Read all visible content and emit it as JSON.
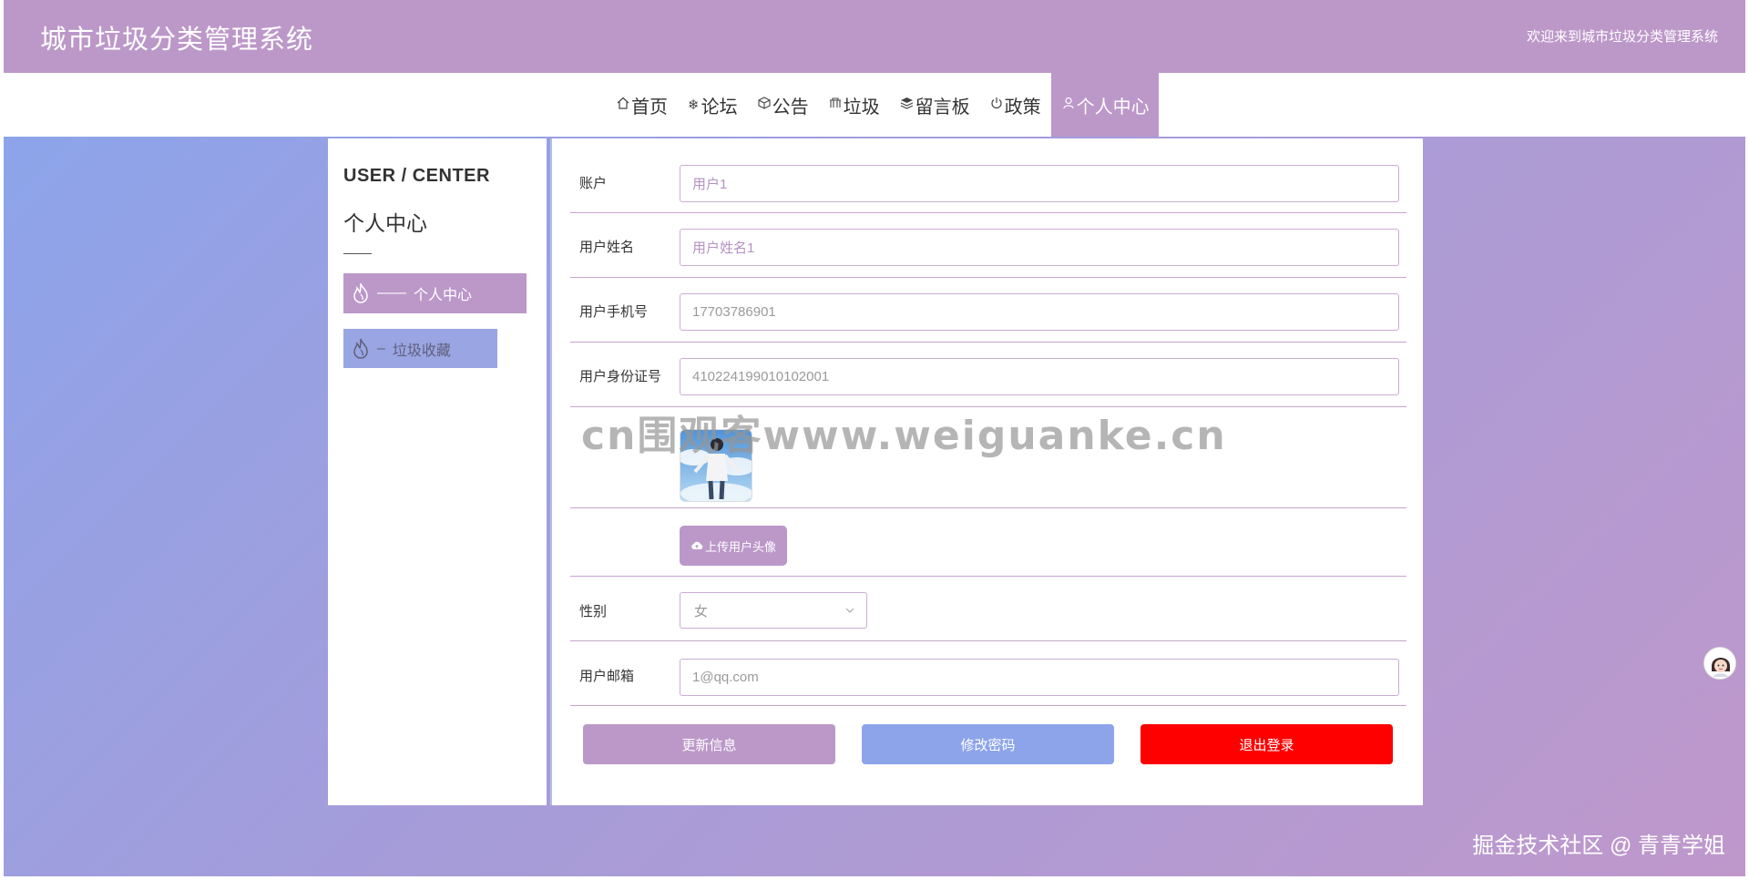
{
  "header": {
    "title": "城市垃圾分类管理系统",
    "welcome": "欢迎来到城市垃圾分类管理系统"
  },
  "nav": {
    "items": [
      {
        "icon": "home-icon",
        "label": "首页"
      },
      {
        "icon": "snowflake-icon",
        "label": "论坛"
      },
      {
        "icon": "cube-icon",
        "label": "公告"
      },
      {
        "icon": "trash-icon",
        "label": "垃圾"
      },
      {
        "icon": "layers-icon",
        "label": "留言板"
      },
      {
        "icon": "power-icon",
        "label": "政策"
      },
      {
        "icon": "user-icon",
        "label": "个人中心"
      }
    ],
    "active": "个人中心"
  },
  "sidebar": {
    "title_en": "USER / CENTER",
    "title_cn": "个人中心",
    "items": [
      {
        "label": "个人中心",
        "dash": "——"
      },
      {
        "label": "垃圾收藏",
        "dash": "–"
      }
    ]
  },
  "form": {
    "account": {
      "label": "账户",
      "value": "用户1"
    },
    "name": {
      "label": "用户姓名",
      "value": "用户姓名1"
    },
    "phone": {
      "label": "用户手机号",
      "value": "17703786901"
    },
    "idcard": {
      "label": "用户身份证号",
      "value": "410224199010102001"
    },
    "upload_label": "上传用户头像",
    "gender": {
      "label": "性别",
      "value": "女"
    },
    "email": {
      "label": "用户邮箱",
      "value": "1@qq.com"
    }
  },
  "actions": {
    "update": "更新信息",
    "change_password": "修改密码",
    "logout": "退出登录"
  },
  "overlay": {
    "watermark": "cn围观客www.weiguanke.cn",
    "corner": "掘金技术社区 @ 青青学姐"
  },
  "colors": {
    "accent": "#bc98c9",
    "secondary": "#8da4ea",
    "danger": "#ff0000"
  }
}
